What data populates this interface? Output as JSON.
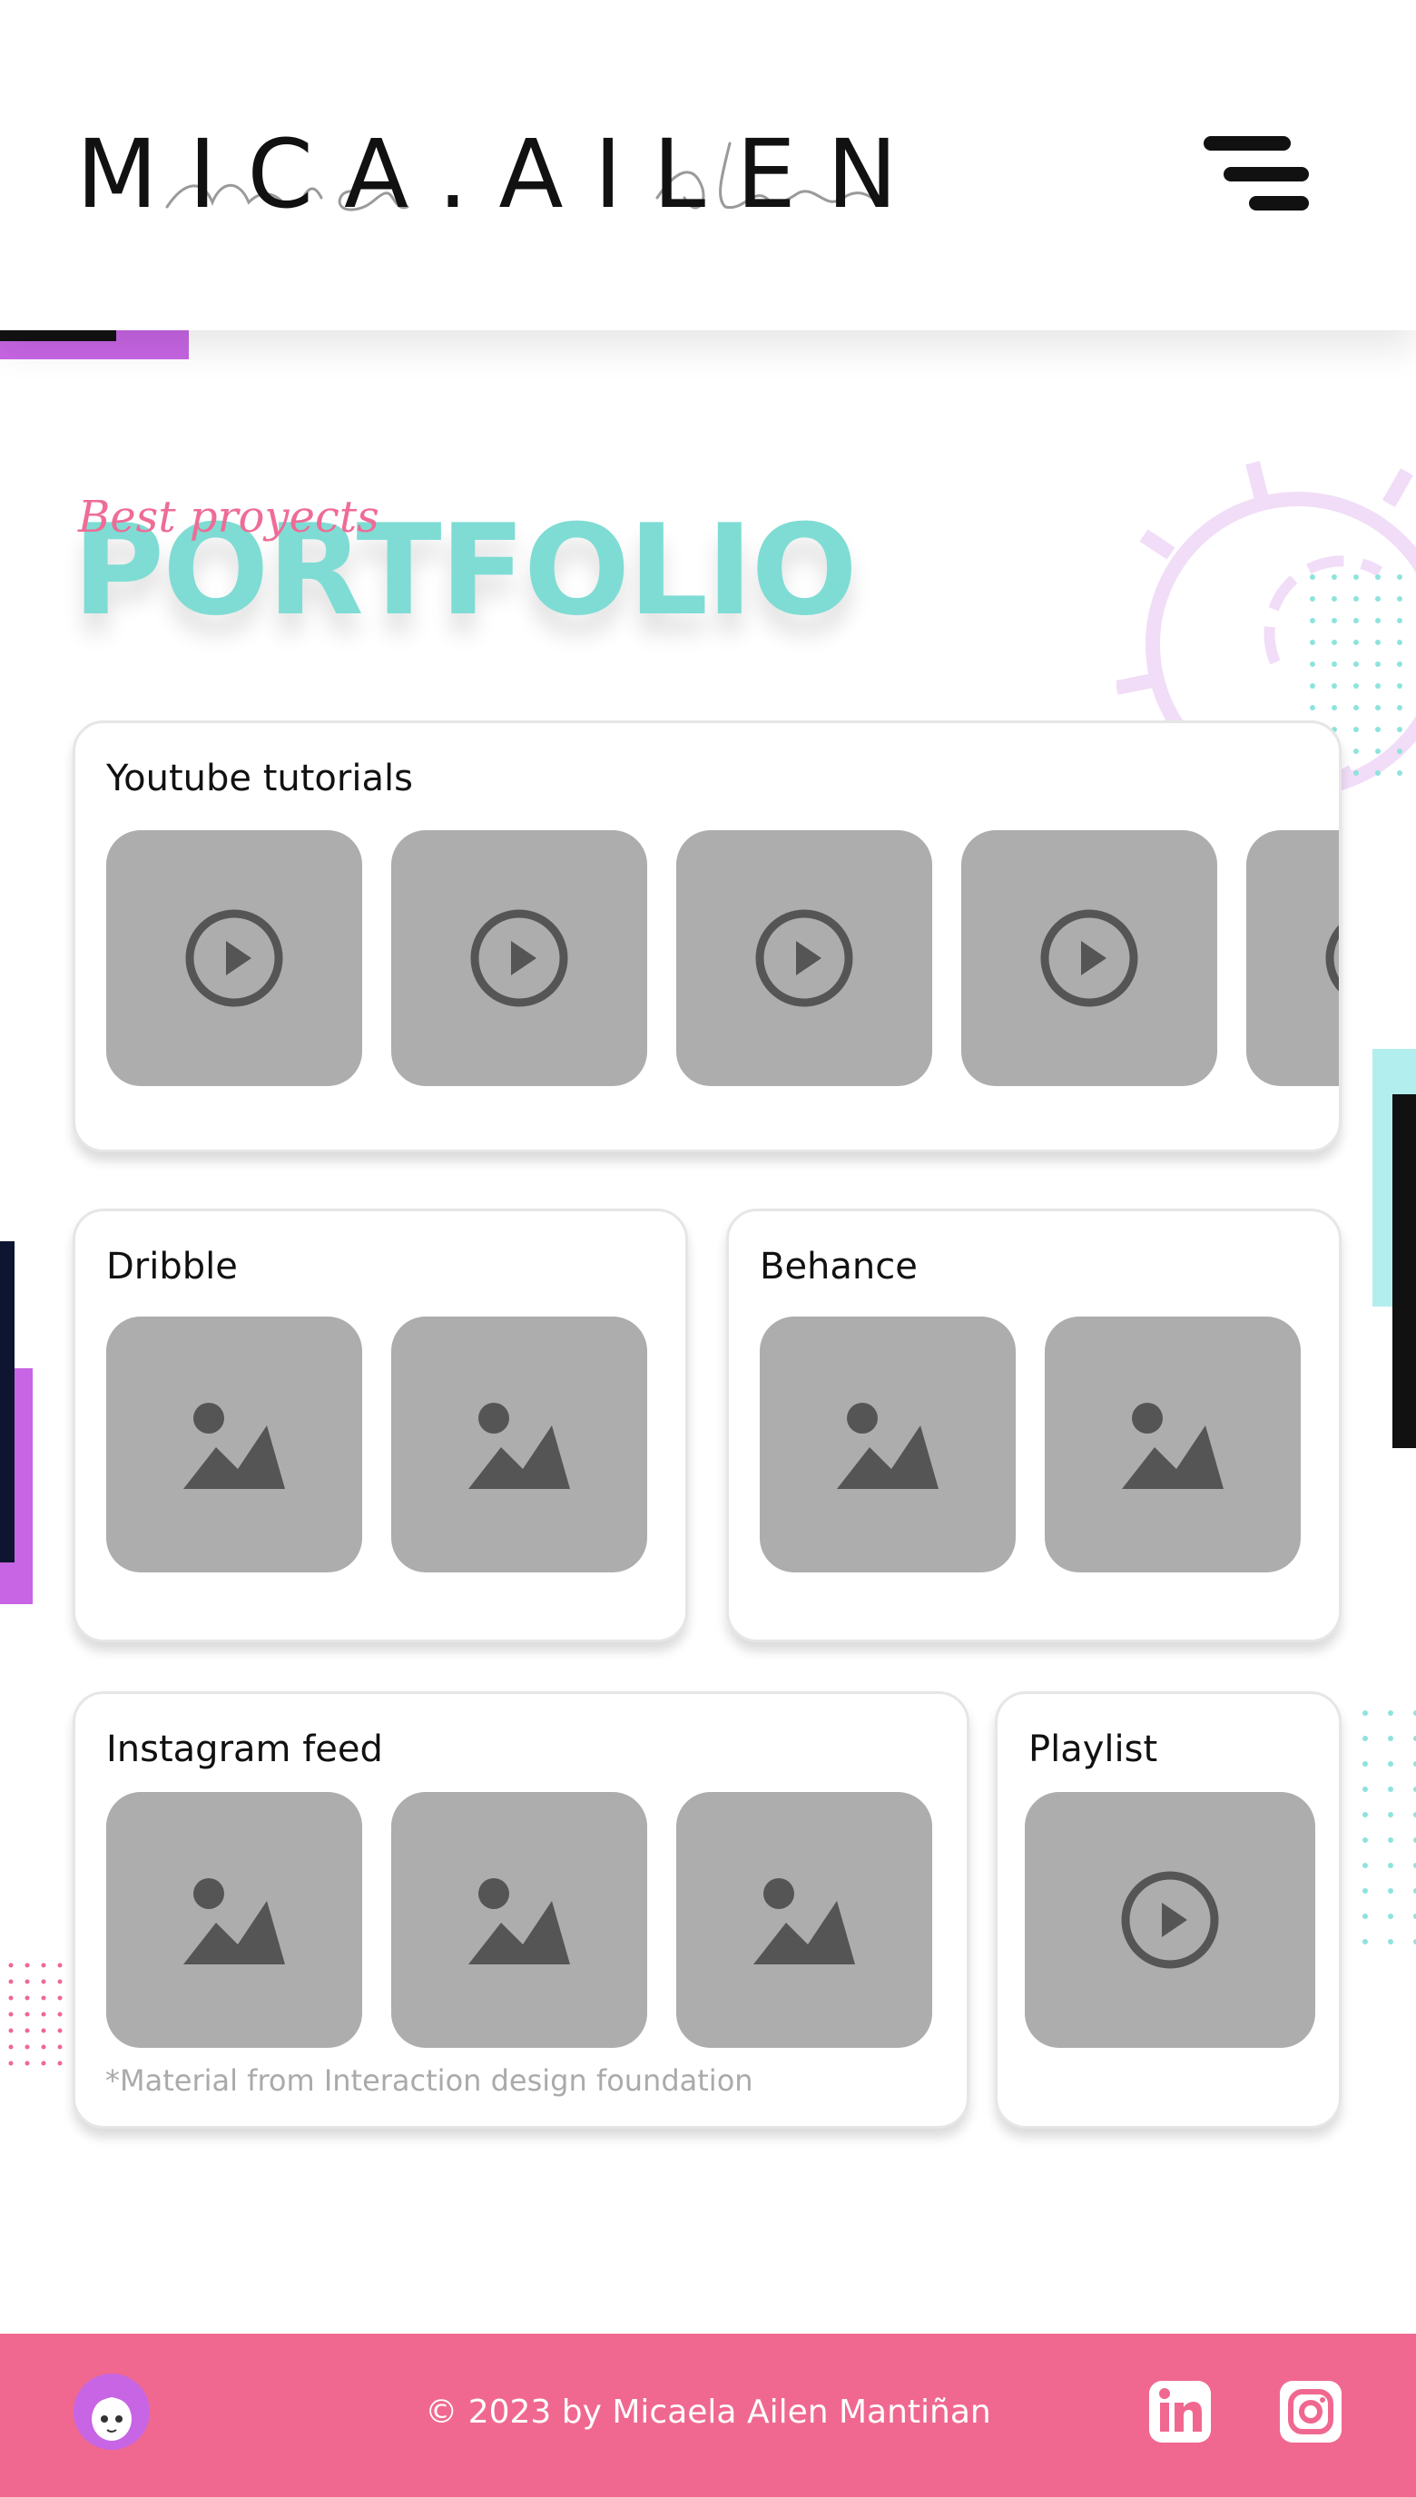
{
  "header": {
    "logo_text": "MICA.AILEN",
    "logo_script": "mica ailen",
    "menu_icon": "hamburger-menu-icon"
  },
  "hero": {
    "script_text": "Best proyects",
    "title": "PORTFOLIO"
  },
  "cards": {
    "youtube": {
      "title": "Youtube tutorials",
      "item_icon": "play-icon"
    },
    "dribble": {
      "title": "Dribble",
      "item_icon": "image-icon"
    },
    "behance": {
      "title": "Behance",
      "item_icon": "image-icon"
    },
    "instagram": {
      "title": "Instagram feed",
      "item_icon": "image-icon",
      "footnote": "*Material from Interaction design foundation"
    },
    "playlist": {
      "title": "Playlist",
      "item_icon": "play-icon"
    }
  },
  "footer": {
    "copyright": "© 2023 by Micaela Ailen Mantiñan",
    "social": [
      "linkedin-icon",
      "instagram-icon"
    ]
  },
  "colors": {
    "accent_teal": "#7fdcd4",
    "accent_pink": "#f06890",
    "accent_purple": "#c765e4",
    "thumb_gray": "#adadad",
    "icon_gray": "#555555"
  }
}
